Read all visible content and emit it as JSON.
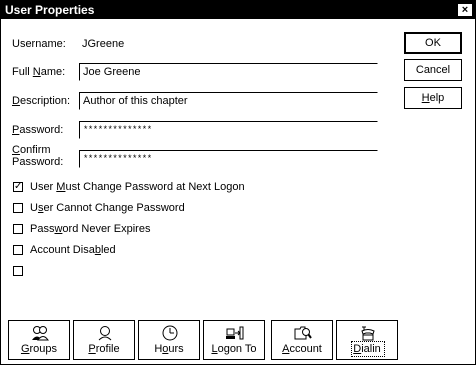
{
  "window": {
    "title": "User Properties",
    "close_label": "×"
  },
  "fields": {
    "username_label": "Username:",
    "username_value": "JGreene",
    "fullname_label": "Full Name:",
    "fullname_value": "Joe Greene",
    "description_label": "Description:",
    "description_value": "Author of this chapter",
    "password_label": "Password:",
    "password_value": "**************",
    "confirm_label_1": "Confirm",
    "confirm_label_2": "Password:",
    "confirm_value": "**************"
  },
  "buttons": {
    "ok": "OK",
    "cancel": "Cancel",
    "help": "Help"
  },
  "checkboxes": [
    {
      "label": "User Must Change Password at Next Logon",
      "checked": true
    },
    {
      "label": "User Cannot Change Password",
      "checked": false
    },
    {
      "label": "Password Never Expires",
      "checked": false
    },
    {
      "label": "Account Disabled",
      "checked": false
    },
    {
      "label": "",
      "checked": false
    }
  ],
  "toolbar": {
    "groups": "Groups",
    "profile": "Profile",
    "hours": "Hours",
    "logon_to": "Logon To",
    "account": "Account",
    "dialin": "Dialin"
  }
}
